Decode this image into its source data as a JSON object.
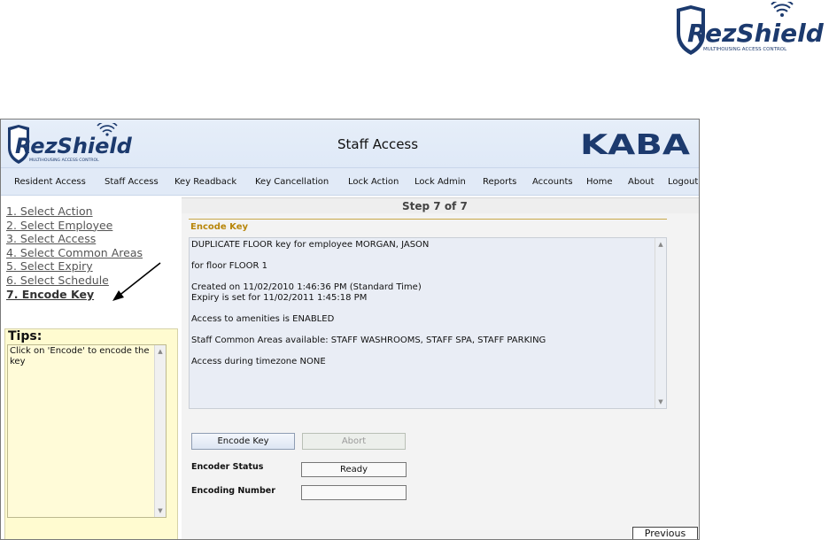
{
  "brand": {
    "name": "RezShield",
    "tagline": "MULTIHOUSING ACCESS CONTROL",
    "partner": "KABA",
    "colors": {
      "navy": "#1c3a6e",
      "accent_gold": "#b8860b",
      "tips_bg": "#fffbd0"
    }
  },
  "header": {
    "title": "Staff Access"
  },
  "nav": {
    "items": [
      {
        "label": "Resident Access"
      },
      {
        "label": "Staff Access"
      },
      {
        "label": "Key Readback"
      },
      {
        "label": "Key Cancellation"
      },
      {
        "label": "Lock Action"
      },
      {
        "label": "Lock Admin"
      },
      {
        "label": "Reports"
      },
      {
        "label": "Accounts"
      },
      {
        "label": "Home"
      },
      {
        "label": "About"
      },
      {
        "label": "Logout"
      }
    ]
  },
  "steps": {
    "items": [
      {
        "label": "1. Select Action"
      },
      {
        "label": "2. Select Employee"
      },
      {
        "label": "3. Select Access"
      },
      {
        "label": "4. Select Common Areas"
      },
      {
        "label": "5. Select Expiry"
      },
      {
        "label": "6. Select Schedule"
      },
      {
        "label": "7. Encode Key"
      }
    ],
    "current": "7. Encode Key"
  },
  "tips": {
    "heading": "Tips:",
    "text": "Click on 'Encode' to encode the key"
  },
  "main": {
    "step_indicator": "Step 7 of 7",
    "section_title": "Encode Key",
    "summary": {
      "line1": "DUPLICATE FLOOR key for employee MORGAN, JASON",
      "line2": "for floor FLOOR 1",
      "line3": "Created on 11/02/2010 1:46:36 PM (Standard Time)",
      "line4": "Expiry is set for 11/02/2011 1:45:18 PM",
      "line5": "Access to amenities is ENABLED",
      "line6": "Staff Common Areas available: STAFF WASHROOMS, STAFF SPA, STAFF PARKING",
      "line7": "Access during timezone NONE"
    },
    "encode_button": "Encode Key",
    "abort_button": "Abort",
    "encoder_status_label": "Encoder Status",
    "encoder_status_value": "Ready",
    "encoding_number_label": "Encoding Number",
    "encoding_number_value": "",
    "previous_button": "Previous"
  },
  "icons": [
    "rezshield-logo",
    "kaba-logo",
    "wifi-signal-icon",
    "arrow-icon",
    "scroll-up-icon",
    "scroll-down-icon"
  ]
}
